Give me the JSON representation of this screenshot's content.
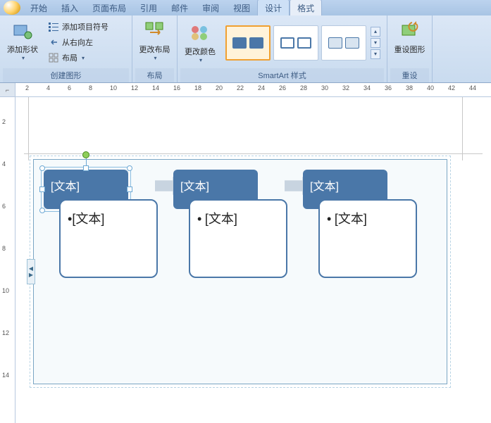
{
  "tabs": {
    "home": "开始",
    "insert": "插入",
    "page_layout": "页面布局",
    "references": "引用",
    "mailings": "邮件",
    "review": "审阅",
    "view": "视图",
    "design": "设计",
    "format": "格式"
  },
  "ribbon": {
    "group_shape": {
      "label": "创建图形",
      "add_shape": "添加形状",
      "add_bullet": "添加项目符号",
      "rtl": "从右向左",
      "layout": "布局"
    },
    "group_layout": {
      "label": "布局",
      "change_layout": "更改布局"
    },
    "group_style": {
      "label": "SmartArt 样式",
      "change_colors": "更改颜色"
    },
    "group_reset": {
      "label": "重设",
      "reset_graphic": "重设图形"
    }
  },
  "ruler": {
    "h": [
      "2",
      "4",
      "6",
      "8",
      "10",
      "12",
      "14",
      "16",
      "18",
      "20",
      "22",
      "24",
      "26",
      "28",
      "30",
      "32",
      "34",
      "36",
      "38",
      "40",
      "42",
      "44"
    ],
    "v": [
      "2",
      "4",
      "6",
      "8",
      "10",
      "12",
      "14"
    ]
  },
  "smartart": {
    "placeholder_main": "[文本]",
    "placeholder_sub": "[文本]",
    "bullet": "•"
  }
}
